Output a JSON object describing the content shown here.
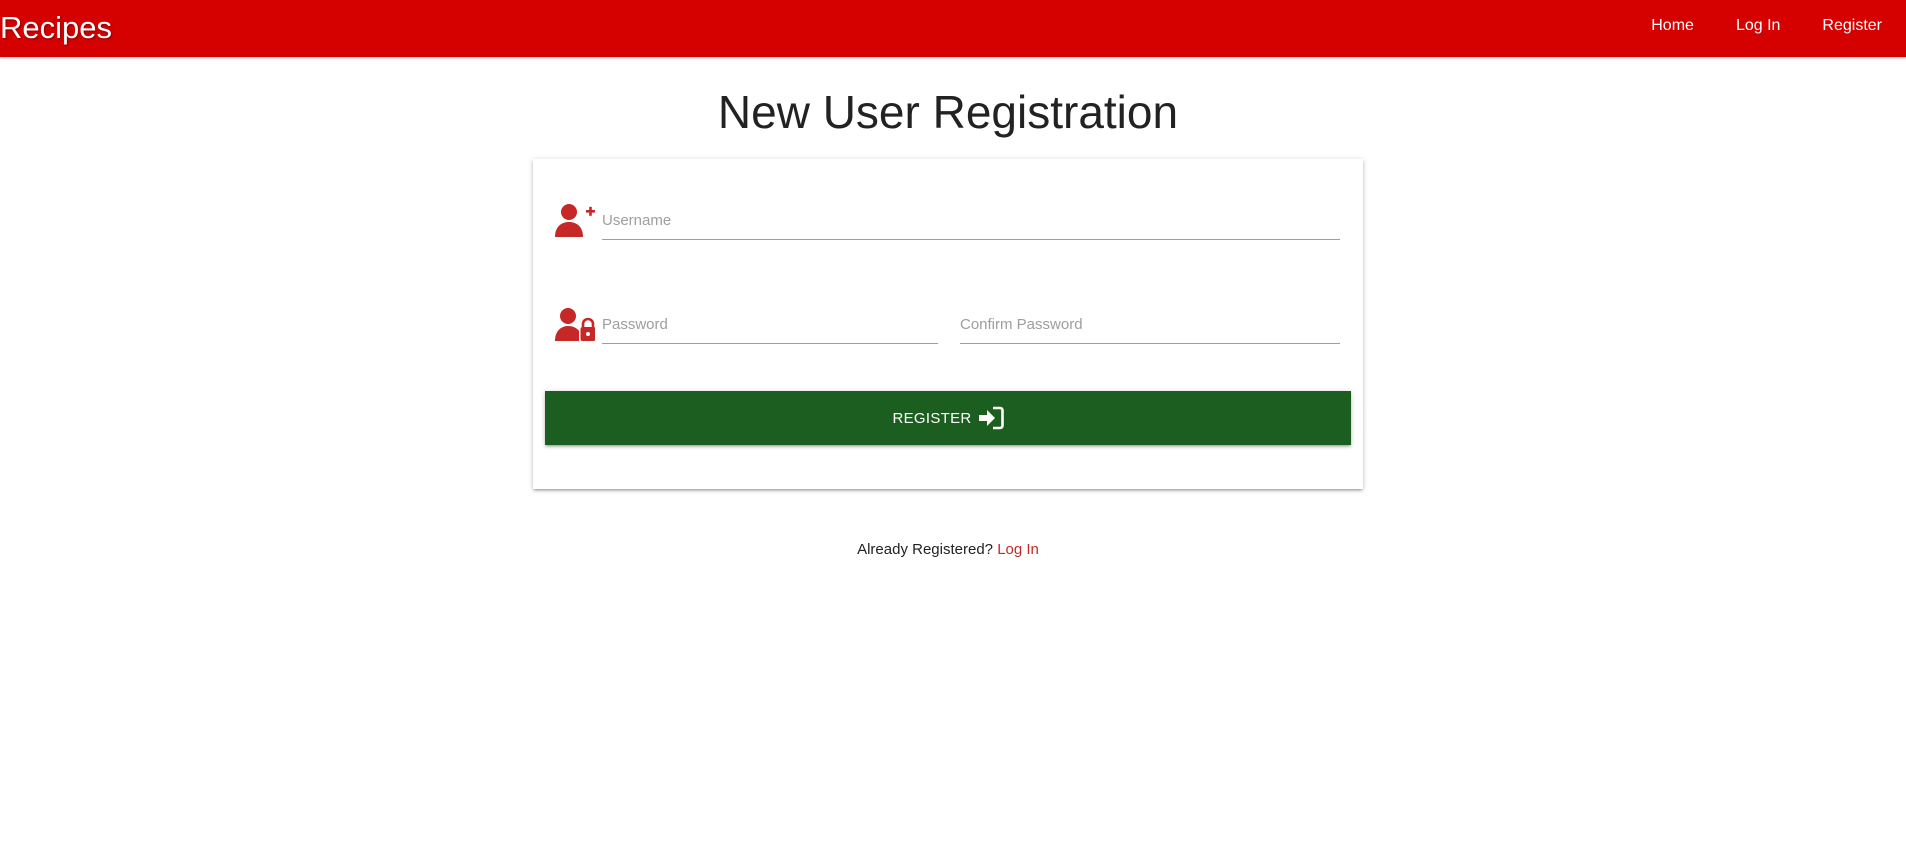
{
  "navbar": {
    "brand": "Recipes",
    "links": [
      {
        "label": "Home"
      },
      {
        "label": "Log In"
      },
      {
        "label": "Register"
      }
    ],
    "background_color": "#d50000"
  },
  "page": {
    "title": "New User Registration"
  },
  "form": {
    "username": {
      "placeholder": "Username",
      "value": "",
      "icon": "user-plus-icon"
    },
    "password": {
      "placeholder": "Password",
      "value": "",
      "icon": "user-lock-icon"
    },
    "confirm_password": {
      "placeholder": "Confirm Password",
      "value": ""
    },
    "submit": {
      "label": "Register",
      "icon": "sign-in-icon",
      "color": "#1b5e20"
    },
    "icon_color": "#c62828"
  },
  "footer": {
    "prompt": "Already Registered?",
    "link_label": "Log In"
  }
}
